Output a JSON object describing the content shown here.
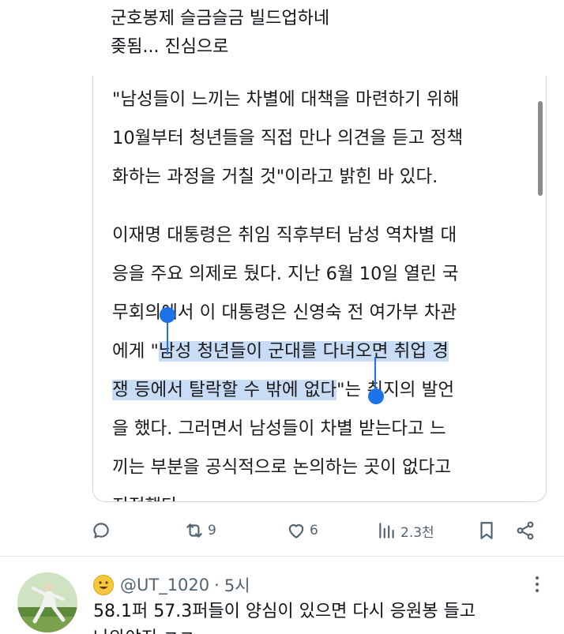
{
  "post": {
    "lines": [
      "군호봉제 슬금슬금 빌드업하네",
      "좆됨... 진심으로"
    ]
  },
  "quote": {
    "para1": [
      "\"남성들이 느끼는 차별에 대책을 마련하기 위해",
      "10월부터 청년들을 직접 만나 의견을 듣고 정책",
      "화하는 과정을 거칠 것\"이라고 밝힌 바 있다."
    ],
    "para2_line1": "이재명 대통령은 취임 직후부터 남성 역차별 대",
    "para2_line2": "응을 주요 의제로 뒀다. 지난 6월 10일 열린 국",
    "para2_line3": "무회의에서 이 대통령은 신영숙 전 여가부 차관",
    "line4_pre": "에게 \"",
    "line4_hl": "남성 청년들이 군대를 다녀오면 취업 경",
    "line5_hl": "쟁 등에서 탈락할 수 밖에 없다",
    "line5_post": "\"는 취지의 발언",
    "para2_line6": "을 했다. 그러면서 남성들이 차별 받는다고 느",
    "para2_line7": "끼는 부분을 공식적으로 논의하는 곳이 없다고",
    "para2_line8": "지적했다."
  },
  "actions": {
    "reply_icon": "reply-bubble-icon",
    "retweet_icon": "retweet-icon",
    "retweets": "9",
    "like_icon": "heart-icon",
    "likes": "6",
    "views_icon": "views-chart-icon",
    "views": "2.3천",
    "bookmark_icon": "bookmark-icon",
    "share_icon": "share-icon"
  },
  "reply": {
    "handle": "@UT_1020",
    "separator": "·",
    "time": "5시",
    "text_line1": "58.1퍼 57.3퍼들이 양심이 있으면 다시 응원봉 들고",
    "text_line2": "나와야지 ㅋㅋ"
  },
  "colors": {
    "selection": "#c8dcf5",
    "handle": "#1d72e8",
    "muted": "#536471"
  }
}
